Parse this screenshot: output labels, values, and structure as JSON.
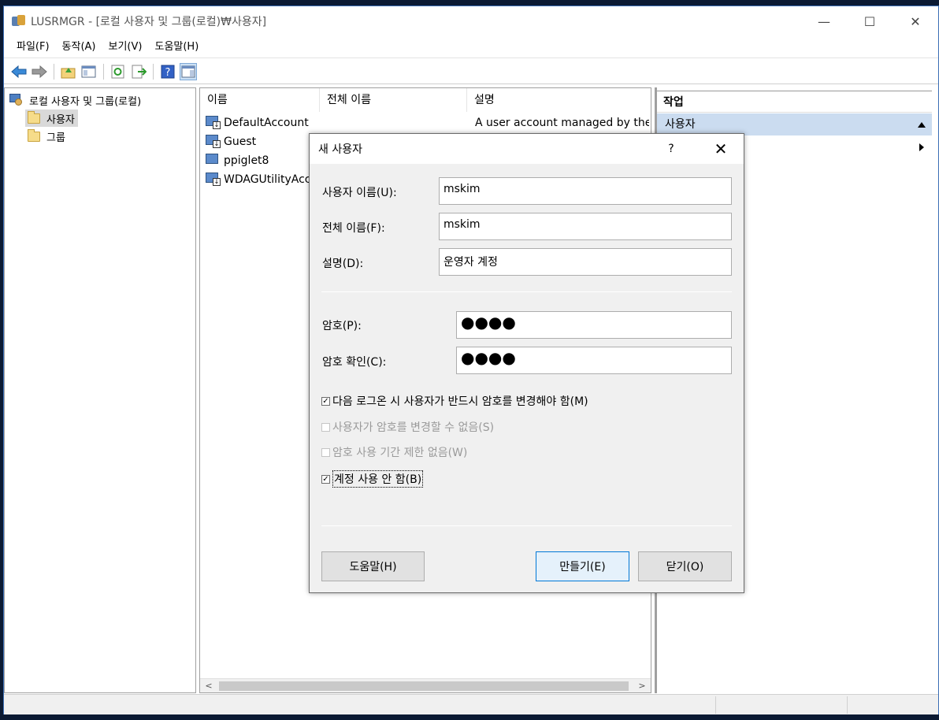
{
  "window": {
    "title": "LUSRMGR - [로컬 사용자 및 그룹(로컬)₩사용자]",
    "minimize_glyph": "—",
    "maximize_glyph": "☐",
    "close_glyph": "✕"
  },
  "menu": [
    "파일(F)",
    "동작(A)",
    "보기(V)",
    "도움말(H)"
  ],
  "toolbar": {
    "icons": [
      "back-arrow-icon",
      "forward-arrow-icon",
      "up-folder-icon",
      "show-hide-tree-icon",
      "refresh-icon",
      "export-list-icon",
      "help-icon",
      "show-hide-action-pane-icon"
    ]
  },
  "tree": {
    "root": "로컬 사용자 및 그룹(로컬)",
    "items": [
      "사용자",
      "그룹"
    ],
    "selected": "사용자"
  },
  "list": {
    "columns": [
      "이름",
      "전체 이름",
      "설명"
    ],
    "rows": [
      {
        "name": "DefaultAccount",
        "full_name": "",
        "description": "A user account managed by the s"
      },
      {
        "name": "Guest",
        "full_name": "",
        "description": ""
      },
      {
        "name": "ppiglet8",
        "full_name": "",
        "description": ""
      },
      {
        "name": "WDAGUtilityAcc...",
        "full_name": "",
        "description": ""
      }
    ],
    "scroll_left": "<",
    "scroll_right": ">"
  },
  "actions": {
    "header": "작업",
    "selected": "사용자"
  },
  "dialog": {
    "title": "새 사용자",
    "help_glyph": "?",
    "close_glyph": "✕",
    "username_label": "사용자 이름(U):",
    "username_value": "mskim",
    "fullname_label": "전체 이름(F):",
    "fullname_value": "mskim",
    "description_label": "설명(D):",
    "description_value": "운영자 계정",
    "password_label": "암호(P):",
    "password_value": "●●●●",
    "confirm_label": "암호 확인(C):",
    "confirm_value": "●●●●",
    "checkboxes": [
      {
        "label": "다음 로그온 시 사용자가 반드시 암호를 변경해야 함(M)",
        "checked": true,
        "enabled": true
      },
      {
        "label": "사용자가 암호를 변경할 수 없음(S)",
        "checked": false,
        "enabled": false
      },
      {
        "label": "암호 사용 기간 제한 없음(W)",
        "checked": false,
        "enabled": false
      },
      {
        "label": "계정 사용 안 함(B)",
        "checked": true,
        "enabled": true
      }
    ],
    "help_button": "도움말(H)",
    "create_button": "만들기(E)",
    "close_button": "닫기(O)",
    "checked_glyph": "☑"
  }
}
